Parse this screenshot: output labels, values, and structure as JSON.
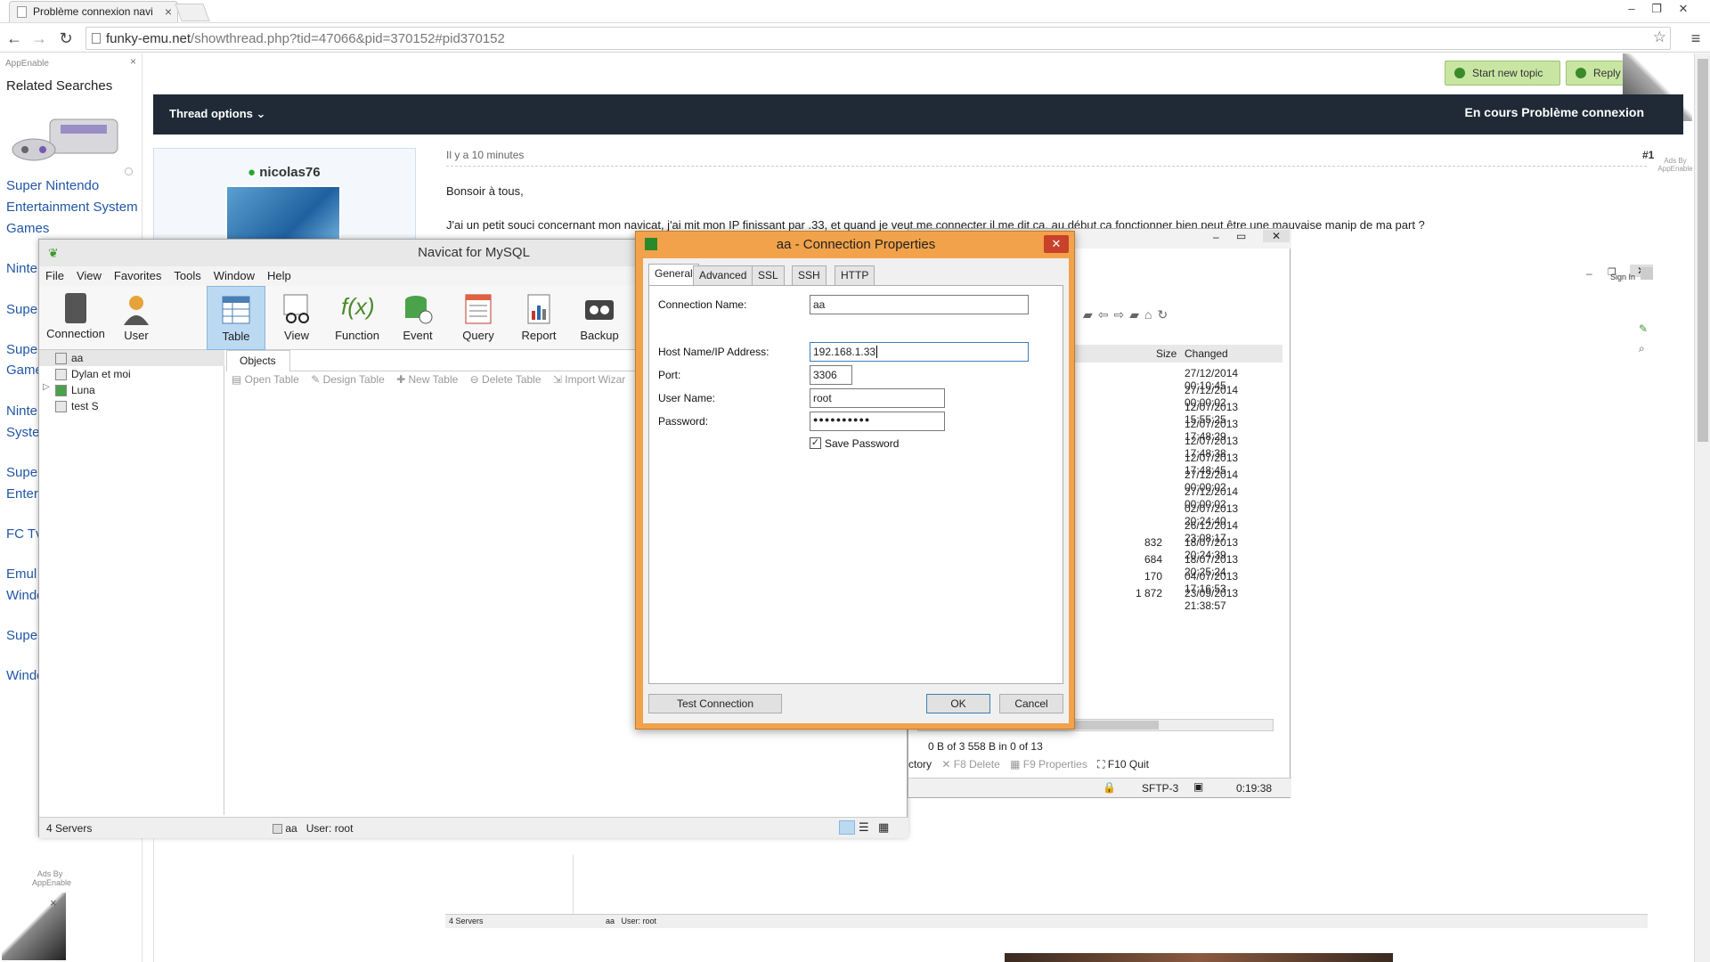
{
  "browser": {
    "tab_title": "Problème connexion navi",
    "url_host": "funky-emu.net",
    "url_path": "/showthread.php?tid=47066&pid=370152#pid370152"
  },
  "sidebar": {
    "brand": "AppEnable",
    "heading": "Related Searches",
    "links": [
      "Super Nintendo",
      "Entertainment System",
      "Games",
      "Ninte",
      "Supe",
      "Supe",
      "Game",
      "Ninte",
      "Syste",
      "Supe",
      "Enter",
      "FC Tv",
      "Emul",
      "Windo",
      "Supe",
      "Windo"
    ],
    "ads_label": "Ads By AppEnable"
  },
  "forum": {
    "start_topic": "Start new topic",
    "reply": "Reply to",
    "thread_options": "Thread options",
    "thread_title": "En cours Problème connexion",
    "username": "nicolas76",
    "time": "Il y a 10 minutes",
    "post_num": "#1",
    "greeting": "Bonsoir à tous,",
    "post_text": "J'ai un petit souci concernant mon navicat, j'ai mit mon IP finissant par .33, et quand je veut me connecter il me dit ça, au début ça fonctionner bien peut être une mauvaise manip de ma part ?",
    "ads_right": "Ads By AppEnable",
    "sign_in": "Sign In"
  },
  "navicat": {
    "title": "Navicat for MySQL",
    "menu": [
      "File",
      "View",
      "Favorites",
      "Tools",
      "Window",
      "Help"
    ],
    "toolbar": [
      "Connection",
      "User",
      "Table",
      "View",
      "Function",
      "Event",
      "Query",
      "Report",
      "Backup"
    ],
    "tree": [
      "aa",
      "Dylan et moi",
      "Luna",
      "test S"
    ],
    "objects_tab": "Objects",
    "obj_actions": [
      "Open Table",
      "Design Table",
      "New Table",
      "Delete Table",
      "Import Wizar"
    ],
    "status_servers": "4 Servers",
    "status_conn": "aa",
    "status_user": "User: root"
  },
  "dialog": {
    "title": "aa - Connection Properties",
    "tabs": [
      "General",
      "Advanced",
      "SSL",
      "SSH",
      "HTTP"
    ],
    "labels": {
      "conn_name": "Connection Name:",
      "host": "Host Name/IP Address:",
      "port": "Port:",
      "user": "User Name:",
      "password": "Password:",
      "save_pw": "Save Password"
    },
    "values": {
      "conn_name": "aa",
      "host": "192.168.1.33",
      "port": "3306",
      "user": "root",
      "password": "●●●●●●●●●●"
    },
    "buttons": {
      "test": "Test Connection",
      "ok": "OK",
      "cancel": "Cancel"
    }
  },
  "winscp": {
    "col_size": "Size",
    "col_changed": "Changed",
    "rows": [
      {
        "size": "",
        "date": "27/12/2014 00:10:45"
      },
      {
        "size": "",
        "date": "27/12/2014 00:00:02"
      },
      {
        "size": "",
        "date": "12/07/2013 15:55:25"
      },
      {
        "size": "",
        "date": "12/07/2013 17:48:29"
      },
      {
        "size": "",
        "date": "12/07/2013 17:48:38"
      },
      {
        "size": "",
        "date": "12/07/2013 17:48:45"
      },
      {
        "size": "",
        "date": "27/12/2014 00:00:02"
      },
      {
        "size": "",
        "date": "27/12/2014 00:00:02"
      },
      {
        "size": "",
        "date": "02/07/2013 20:24:40"
      },
      {
        "size": "",
        "date": "26/12/2014 23:08:17"
      },
      {
        "size": "832",
        "date": "18/07/2013 20:24:39"
      },
      {
        "size": "684",
        "date": "18/07/2013 20:25:24"
      },
      {
        "size": "170",
        "date": "04/07/2013 17:16:53"
      },
      {
        "size": "1 872",
        "date": "23/09/2013 21:38:57"
      }
    ],
    "summary": "0 B of 3 558 B in 0 of 13",
    "fkeys": [
      "ctory",
      "F8 Delete",
      "F9 Properties",
      "F10 Quit"
    ],
    "protocol": "SFTP-3",
    "elapsed": "0:19:38"
  },
  "bottom": {
    "servers": "4 Servers",
    "conn": "aa",
    "user": "User: root"
  }
}
